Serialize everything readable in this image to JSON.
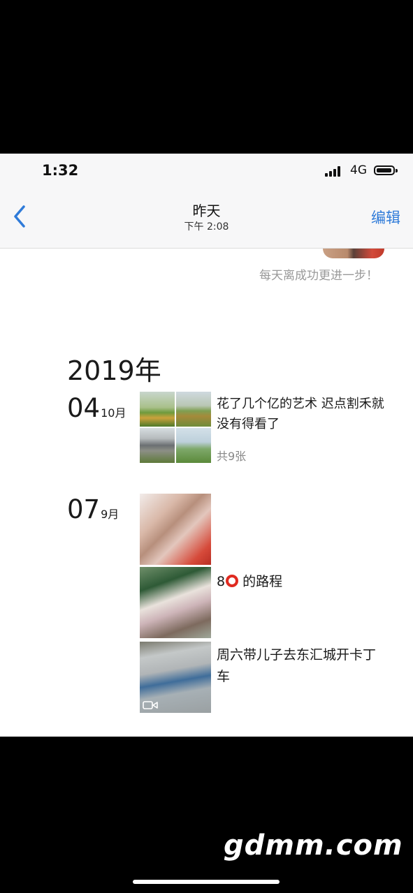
{
  "status_bar": {
    "time": "1:32",
    "network": "4G"
  },
  "nav": {
    "title": "昨天",
    "subtitle": "下午 2:08",
    "edit_label": "编辑",
    "back_icon": "chevron-left-icon"
  },
  "profile": {
    "signature": "每天离成功更进一步！"
  },
  "timeline": {
    "year": "2019年",
    "posts": [
      {
        "day": "04",
        "month": "10月",
        "caption": "花了几个亿的艺术 迟点割禾就没有得看了",
        "photo_count": "共9张"
      },
      {
        "day": "07",
        "month": "9月",
        "caption_number": "8",
        "caption_rest": "的路程",
        "video_caption": "周六带儿子去东汇城开卡丁车"
      }
    ]
  },
  "colors": {
    "accent": "#2f7bd9",
    "ring": "#e02a20"
  },
  "watermark": "gdmm.com"
}
